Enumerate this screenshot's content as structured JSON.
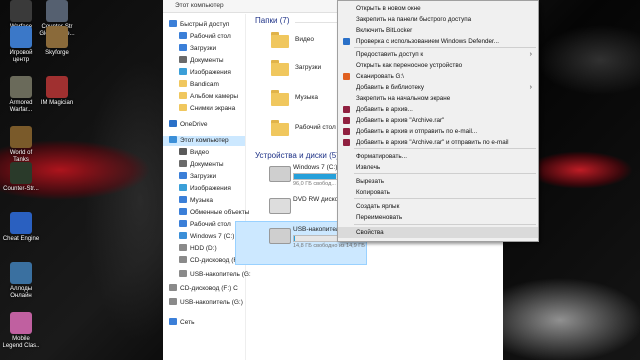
{
  "desktop": {
    "icons": [
      {
        "label": "Warface",
        "color": "#3a3a3a"
      },
      {
        "label": "Counter-Str Global Offe...",
        "color": "#556070"
      },
      {
        "label": "Игровой центр",
        "color": "#3b78c8"
      },
      {
        "label": "Skyforge",
        "color": "#8a6a3a"
      },
      {
        "label": "Armored Warfar...",
        "color": "#6a6a5a"
      },
      {
        "label": "IM Magician",
        "color": "#a03030"
      },
      {
        "label": "World of Tanks",
        "color": "#7a5a2a"
      },
      {
        "label": "Counter-Str...",
        "color": "#2a3a2a"
      },
      {
        "label": "Cheat Engine",
        "color": "#2a60c0"
      },
      {
        "label": "Аллоды Онлайн",
        "color": "#3a70a0"
      },
      {
        "label": "Mobile Legend Clas..",
        "color": "#c060a0"
      }
    ]
  },
  "explorer": {
    "breadcrumb": "Этот компьютер",
    "nav": [
      {
        "label": "Быстрый доступ",
        "color": "#3b7fd8"
      },
      {
        "label": "Рабочий стол",
        "color": "#3b7fd8"
      },
      {
        "label": "Загрузки",
        "color": "#3b7fd8"
      },
      {
        "label": "Документы",
        "color": "#6a6a6a"
      },
      {
        "label": "Изображения",
        "color": "#3b9fd8"
      },
      {
        "label": "Bandicam",
        "color": "#f0c75e"
      },
      {
        "label": "Альбом камеры",
        "color": "#f0c75e"
      },
      {
        "label": "Снимки экрана",
        "color": "#f0c75e"
      },
      {
        "label": "OneDrive",
        "color": "#2a70c8"
      },
      {
        "label": "Этот компьютер",
        "color": "#3b8fd8"
      },
      {
        "label": "Видео",
        "color": "#5a5a5a"
      },
      {
        "label": "Документы",
        "color": "#6a6a6a"
      },
      {
        "label": "Загрузки",
        "color": "#3b7fd8"
      },
      {
        "label": "Изображения",
        "color": "#3b9fd8"
      },
      {
        "label": "Музыка",
        "color": "#3b7fd8"
      },
      {
        "label": "Обменные объекты",
        "color": "#3b7fd8"
      },
      {
        "label": "Рабочий стол",
        "color": "#3b7fd8"
      },
      {
        "label": "Windows 7 (C:)",
        "color": "#3b8fd8"
      },
      {
        "label": "HDD (D:)",
        "color": "#8a8a8a"
      },
      {
        "label": "CD-дисковод (F:) C",
        "color": "#8a8a8a"
      },
      {
        "label": "USB-накопитель (G:",
        "color": "#8a8a8a"
      },
      {
        "label": "CD-дисковод (F:) C",
        "color": "#8a8a8a"
      },
      {
        "label": "USB-накопитель (G:)",
        "color": "#8a8a8a"
      },
      {
        "label": "Сеть",
        "color": "#3b7fd8"
      }
    ],
    "folders_header": "Папки (7)",
    "folders": [
      "Видео",
      "Загрузки",
      "Музыка",
      "Рабочий стол"
    ],
    "devices_header": "Устройства и диски (5)",
    "drives": [
      {
        "name": "Windows 7 (C:)",
        "free": "96,0 ГБ свобод...",
        "fill": 0.6
      },
      {
        "name": "DVD RW дисков",
        "free": "",
        "fill": null
      },
      {
        "name": "USB-накопител",
        "free": "14,8 ГБ свободно из 14,9 ГБ",
        "fill": 0.02
      }
    ]
  },
  "context_menu": {
    "items": [
      {
        "label": "Открыть в новом окне",
        "icon": "",
        "arrow": false
      },
      {
        "label": "Закрепить на панели быстрого доступа",
        "icon": "",
        "arrow": false
      },
      {
        "label": "Включить BitLocker",
        "icon": "",
        "arrow": false
      },
      {
        "label": "Проверка с использованием Windows Defender...",
        "icon": "#2a70c8",
        "arrow": false
      },
      {
        "label": "Предоставить доступ к",
        "icon": "",
        "arrow": true
      },
      {
        "label": "Открыть как переносное устройство",
        "icon": "",
        "arrow": false
      },
      {
        "label": "Сканировать G:\\",
        "icon": "#e06020",
        "arrow": false
      },
      {
        "label": "Добавить в библиотеку",
        "icon": "",
        "arrow": true
      },
      {
        "label": "Закрепить на начальном экране",
        "icon": "",
        "arrow": false
      },
      {
        "label": "Добавить в архив...",
        "icon": "#902040",
        "arrow": false
      },
      {
        "label": "Добавить в архив \"Archive.rar\"",
        "icon": "#902040",
        "arrow": false
      },
      {
        "label": "Добавить в архив и отправить по e-mail...",
        "icon": "#902040",
        "arrow": false
      },
      {
        "label": "Добавить в архив \"Archive.rar\" и отправить по e-mail",
        "icon": "#902040",
        "arrow": false
      },
      {
        "label": "Форматировать...",
        "icon": "",
        "arrow": false
      },
      {
        "label": "Извлечь",
        "icon": "",
        "arrow": false
      },
      {
        "label": "Вырезать",
        "icon": "",
        "arrow": false
      },
      {
        "label": "Копировать",
        "icon": "",
        "arrow": false
      },
      {
        "label": "Создать ярлык",
        "icon": "",
        "arrow": false
      },
      {
        "label": "Переименовать",
        "icon": "",
        "arrow": false
      },
      {
        "label": "Свойства",
        "icon": "",
        "arrow": false
      }
    ],
    "highlighted_index": 19
  },
  "colors": {
    "accent": "#26a0da",
    "selection": "#cce8ff"
  }
}
